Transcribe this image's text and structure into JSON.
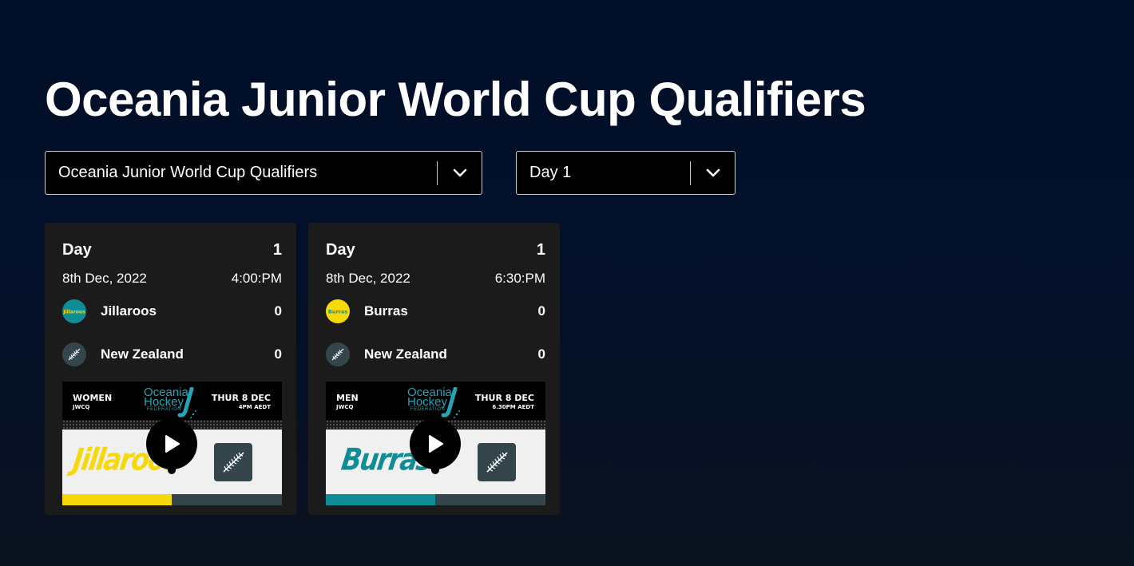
{
  "page": {
    "title": "Oceania Junior World Cup Qualifiers"
  },
  "filters": {
    "event": {
      "selected": "Oceania Junior World Cup Qualifiers"
    },
    "day": {
      "selected": "Day 1"
    }
  },
  "colors": {
    "background": "#000e27",
    "card": "#1b1b1b",
    "jillaroos_yellow": "#f5d90a",
    "burras_teal": "#0f8c96",
    "nz_slate": "#34464c",
    "ohf_teal": "#25a4b6"
  },
  "matches": [
    {
      "day_label": "Day",
      "day_number": "1",
      "date": "8th Dec, 2022",
      "time": "4:00:PM",
      "team1": {
        "name": "Jillaroos",
        "score": "0",
        "logo_icon": "jillaroos-logo-icon",
        "logo_text": "Jillaroos"
      },
      "team2": {
        "name": "New Zealand",
        "score": "0",
        "logo_icon": "silver-fern-icon"
      },
      "thumbnail": {
        "category": "WOMEN",
        "competition": "JWCQ",
        "date": "THUR 8 DEC",
        "time": "4PM AEDT",
        "org_line1": "Oceania",
        "org_line2": "Hockey",
        "org_line3": "FEDERATION",
        "team_script": "Jillaroos",
        "play_icon": "play-icon"
      }
    },
    {
      "day_label": "Day",
      "day_number": "1",
      "date": "8th Dec, 2022",
      "time": "6:30:PM",
      "team1": {
        "name": "Burras",
        "score": "0",
        "logo_icon": "burras-logo-icon",
        "logo_text": "Burras"
      },
      "team2": {
        "name": "New Zealand",
        "score": "0",
        "logo_icon": "silver-fern-icon"
      },
      "thumbnail": {
        "category": "MEN",
        "competition": "JWCQ",
        "date": "THUR 8 DEC",
        "time": "6.30PM AEDT",
        "org_line1": "Oceania",
        "org_line2": "Hockey",
        "org_line3": "FEDERATION",
        "team_script": "Burras",
        "play_icon": "play-icon"
      }
    }
  ]
}
